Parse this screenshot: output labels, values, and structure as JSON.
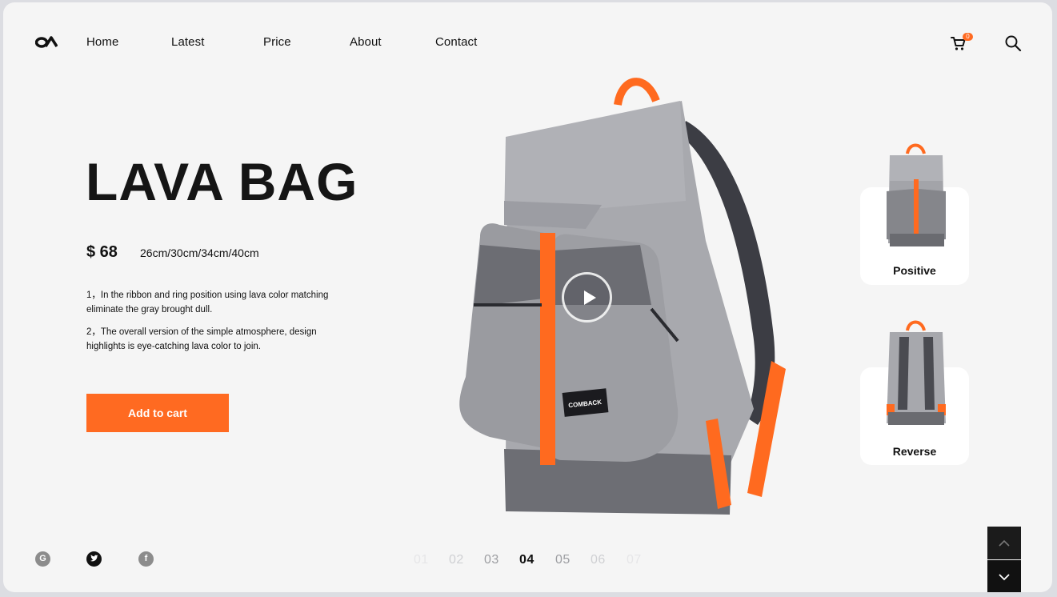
{
  "header": {
    "logo": "oa-logo",
    "nav": [
      "Home",
      "Latest",
      "Price",
      "About",
      "Contact"
    ],
    "cart_badge": "0",
    "cart_icon": "cart-icon",
    "search_icon": "search-icon"
  },
  "product": {
    "title": "LAVA BAG",
    "price": "$ 68",
    "sizes": "26cm/30cm/34cm/40cm",
    "description": [
      "1，In the ribbon and ring position using lava color matching eliminate the gray brought dull.",
      "2，The overall version of the simple atmosphere, design highlights is eye-catching lava color to join."
    ],
    "cta": "Add to cart",
    "brand_patch": "COMBACK"
  },
  "views": [
    {
      "label": "Positive"
    },
    {
      "label": "Reverse"
    }
  ],
  "social": [
    {
      "icon": "google-icon",
      "glyph": "G"
    },
    {
      "icon": "twitter-icon",
      "glyph": ""
    },
    {
      "icon": "facebook-icon",
      "glyph": "f"
    }
  ],
  "pager": {
    "pages": [
      "01",
      "02",
      "03",
      "04",
      "05",
      "06",
      "07"
    ],
    "current": "04"
  },
  "colors": {
    "accent": "#ff6a21",
    "text": "#111111",
    "background": "#f5f5f5"
  }
}
